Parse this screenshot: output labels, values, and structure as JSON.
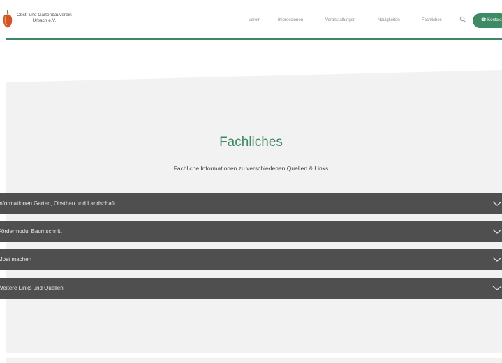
{
  "brand": {
    "line1": "Obst- und Gartenbauverein",
    "line2": "Urbach e.V."
  },
  "nav": {
    "items": [
      {
        "label": "Verein"
      },
      {
        "label": "Impressionen"
      },
      {
        "label": "Veranstaltungen"
      },
      {
        "label": "Neuigkeiten"
      },
      {
        "label": "Fachliches"
      }
    ],
    "cta_label": "Kontakt"
  },
  "hero": {
    "title": "Fachliches",
    "subtitle": "Fachliche Informationen zu verschiedenen Quellen & Links"
  },
  "accordion": {
    "items": [
      {
        "label": "Informationen Garten, Obstbau und Landschaft"
      },
      {
        "label": "Fördermodul Baumschnitt"
      },
      {
        "label": "Most machen"
      },
      {
        "label": "Weitere Links und Quellen"
      }
    ]
  },
  "colors": {
    "accent": "#3d8a64",
    "accordion_bg": "#4f4f4f",
    "band_bg": "#f2f2f2"
  },
  "icons": {
    "logo": "apple-logo-icon",
    "search": "search-icon",
    "cta": "phone-icon",
    "chevron": "chevron-down-icon"
  }
}
